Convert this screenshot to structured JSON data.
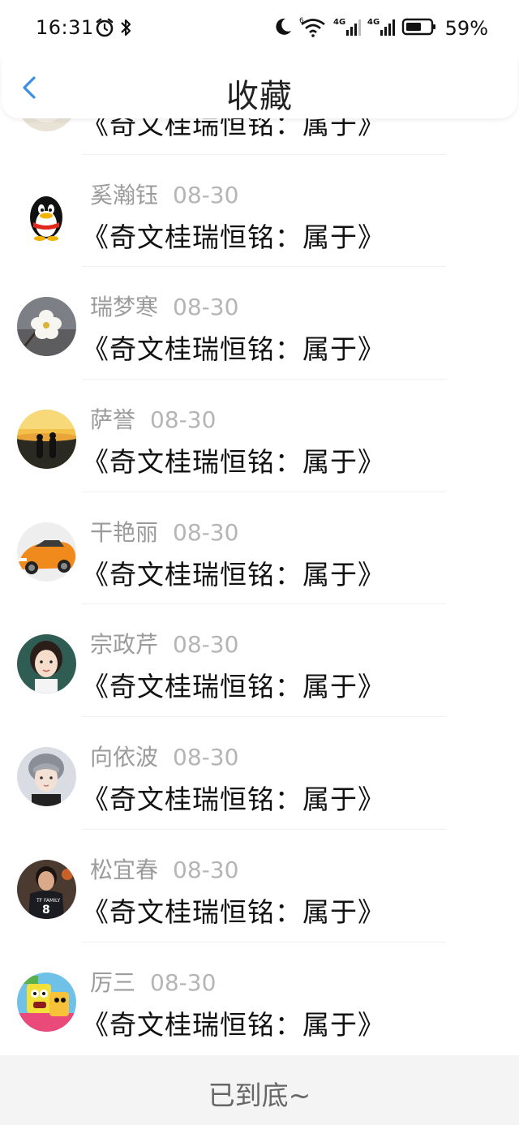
{
  "status_bar": {
    "time": "16:31",
    "battery": "59%",
    "network_1": "4G",
    "network_2": "4G",
    "wifi_badge": "6"
  },
  "header": {
    "title": "收藏",
    "back_icon": "chevron-left-icon",
    "accent": "#3b8fe6"
  },
  "list": {
    "items": [
      {
        "name": "",
        "date": "",
        "book": "《奇文桂瑞恒铭：属于》",
        "avatar": "partial"
      },
      {
        "name": "奚瀚钰",
        "date": "08-30",
        "book": "《奇文桂瑞恒铭：属于》",
        "avatar": "qq-penguin"
      },
      {
        "name": "瑞梦寒",
        "date": "08-30",
        "book": "《奇文桂瑞恒铭：属于》",
        "avatar": "white-blossom"
      },
      {
        "name": "萨誉",
        "date": "08-30",
        "book": "《奇文桂瑞恒铭：属于》",
        "avatar": "sunset-couple"
      },
      {
        "name": "干艳丽",
        "date": "08-30",
        "book": "《奇文桂瑞恒铭：属于》",
        "avatar": "orange-car"
      },
      {
        "name": "宗政芹",
        "date": "08-30",
        "book": "《奇文桂瑞恒铭：属于》",
        "avatar": "girl-portrait"
      },
      {
        "name": "向依波",
        "date": "08-30",
        "book": "《奇文桂瑞恒铭：属于》",
        "avatar": "boy-portrait"
      },
      {
        "name": "松宜春",
        "date": "08-30",
        "book": "《奇文桂瑞恒铭：属于》",
        "avatar": "basketball-player"
      },
      {
        "name": "厉三",
        "date": "08-30",
        "book": "《奇文桂瑞恒铭：属于》",
        "avatar": "cartoon-sponge"
      }
    ]
  },
  "footer": {
    "text": "已到底~"
  }
}
